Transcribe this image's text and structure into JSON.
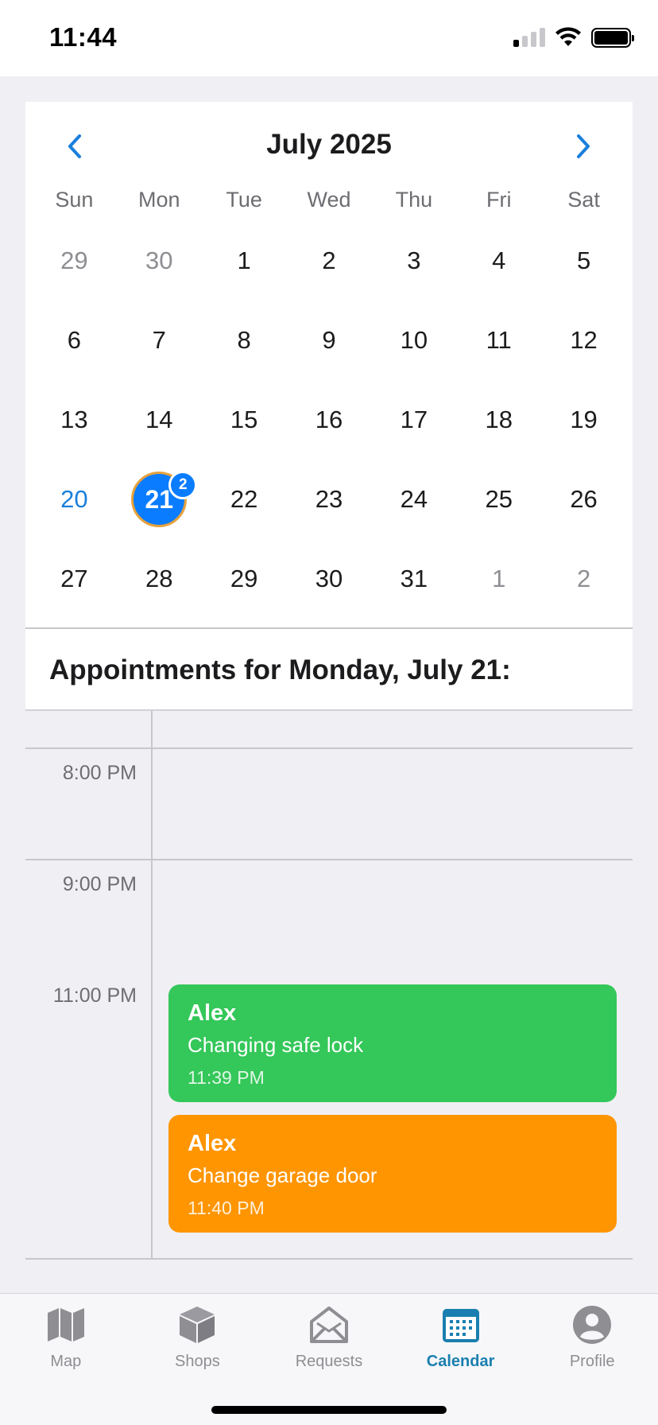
{
  "status_bar": {
    "time": "11:44"
  },
  "calendar": {
    "month_title": "July 2025",
    "weekdays": [
      "Sun",
      "Mon",
      "Tue",
      "Wed",
      "Thu",
      "Fri",
      "Sat"
    ],
    "days": [
      {
        "label": "29",
        "state": "muted"
      },
      {
        "label": "30",
        "state": "muted"
      },
      {
        "label": "1",
        "state": ""
      },
      {
        "label": "2",
        "state": ""
      },
      {
        "label": "3",
        "state": ""
      },
      {
        "label": "4",
        "state": ""
      },
      {
        "label": "5",
        "state": ""
      },
      {
        "label": "6",
        "state": ""
      },
      {
        "label": "7",
        "state": ""
      },
      {
        "label": "8",
        "state": ""
      },
      {
        "label": "9",
        "state": ""
      },
      {
        "label": "10",
        "state": ""
      },
      {
        "label": "11",
        "state": ""
      },
      {
        "label": "12",
        "state": ""
      },
      {
        "label": "13",
        "state": ""
      },
      {
        "label": "14",
        "state": ""
      },
      {
        "label": "15",
        "state": ""
      },
      {
        "label": "16",
        "state": ""
      },
      {
        "label": "17",
        "state": ""
      },
      {
        "label": "18",
        "state": ""
      },
      {
        "label": "19",
        "state": ""
      },
      {
        "label": "20",
        "state": "today"
      },
      {
        "label": "21",
        "state": "selected",
        "badge": "2"
      },
      {
        "label": "22",
        "state": ""
      },
      {
        "label": "23",
        "state": ""
      },
      {
        "label": "24",
        "state": ""
      },
      {
        "label": "25",
        "state": ""
      },
      {
        "label": "26",
        "state": ""
      },
      {
        "label": "27",
        "state": ""
      },
      {
        "label": "28",
        "state": ""
      },
      {
        "label": "29",
        "state": ""
      },
      {
        "label": "30",
        "state": ""
      },
      {
        "label": "31",
        "state": ""
      },
      {
        "label": "1",
        "state": "muted"
      },
      {
        "label": "2",
        "state": "muted"
      }
    ]
  },
  "appointments": {
    "title": "Appointments for Monday, July 21:",
    "time_labels": [
      "8:00 PM",
      "9:00 PM",
      "11:00 PM"
    ],
    "events": [
      {
        "name": "Alex",
        "description": "Changing safe lock",
        "time": "11:39 PM",
        "color": "#34c759"
      },
      {
        "name": "Alex",
        "description": "Change garage door",
        "time": "11:40 PM",
        "color": "#ff9500"
      }
    ]
  },
  "tab_bar": {
    "tabs": [
      {
        "label": "Map",
        "icon": "map-icon",
        "active": false
      },
      {
        "label": "Shops",
        "icon": "box-icon",
        "active": false
      },
      {
        "label": "Requests",
        "icon": "envelope-icon",
        "active": false
      },
      {
        "label": "Calendar",
        "icon": "calendar-icon",
        "active": true
      },
      {
        "label": "Profile",
        "icon": "profile-icon",
        "active": false
      }
    ]
  },
  "colors": {
    "accent": "#0a7cff",
    "active_tab": "#1a7fb0",
    "selected_day_ring": "#e6a23c"
  }
}
